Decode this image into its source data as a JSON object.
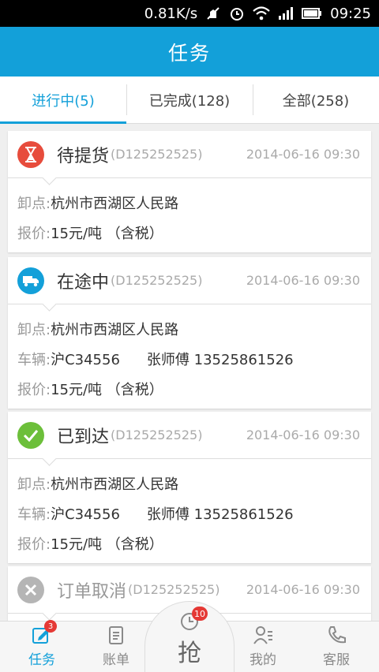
{
  "status_bar": {
    "speed": "0.81K/s",
    "time": "09:25"
  },
  "app_bar": {
    "title": "任务"
  },
  "tabs": [
    {
      "label": "进行中(5)",
      "active": true
    },
    {
      "label": "已完成(128)",
      "active": false
    },
    {
      "label": "全部(258)",
      "active": false
    }
  ],
  "cards": [
    {
      "status": "待提货",
      "status_icon": "hourglass-icon",
      "color": "#e74c3c",
      "order_no": "(D125252525)",
      "time": "2014-06-16  09:30",
      "unload_label": "卸点:",
      "unload": "杭州市西湖区人民路",
      "price_label": "报价:",
      "price": "15元/吨 （含税）"
    },
    {
      "status": "在途中",
      "status_icon": "truck-icon",
      "color": "#13a0d9",
      "order_no": "(D125252525)",
      "time": "2014-06-16  09:30",
      "unload_label": "卸点:",
      "unload": "杭州市西湖区人民路",
      "vehicle_label": "车辆:",
      "plate": "沪C34556",
      "driver": "张师傅 13525861526",
      "price_label": "报价:",
      "price": "15元/吨 （含税）"
    },
    {
      "status": "已到达",
      "status_icon": "check-icon",
      "color": "#6cbf3a",
      "order_no": "(D125252525)",
      "time": "2014-06-16  09:30",
      "unload_label": "卸点:",
      "unload": "杭州市西湖区人民路",
      "vehicle_label": "车辆:",
      "plate": "沪C34556",
      "driver": "张师傅 13525861526",
      "price_label": "报价:",
      "price": "15元/吨 （含税）"
    },
    {
      "status": "订单取消",
      "status_icon": "close-circle-icon",
      "color": "#b5b5b5",
      "order_no": "(D125252525)",
      "time": "2014-06-16  09:30"
    }
  ],
  "bottom_nav": {
    "task": {
      "label": "任务",
      "badge": "3",
      "icon": "edit-icon"
    },
    "bill": {
      "label": "账单",
      "icon": "clipboard-icon"
    },
    "grab": {
      "label": "抢",
      "badge": "10",
      "icon": "clock-icon"
    },
    "mine": {
      "label": "我的",
      "icon": "profile-icon"
    },
    "service": {
      "label": "客服",
      "icon": "phone-icon"
    }
  },
  "colors": {
    "primary": "#13a0d9",
    "accent_red": "#e53935"
  }
}
